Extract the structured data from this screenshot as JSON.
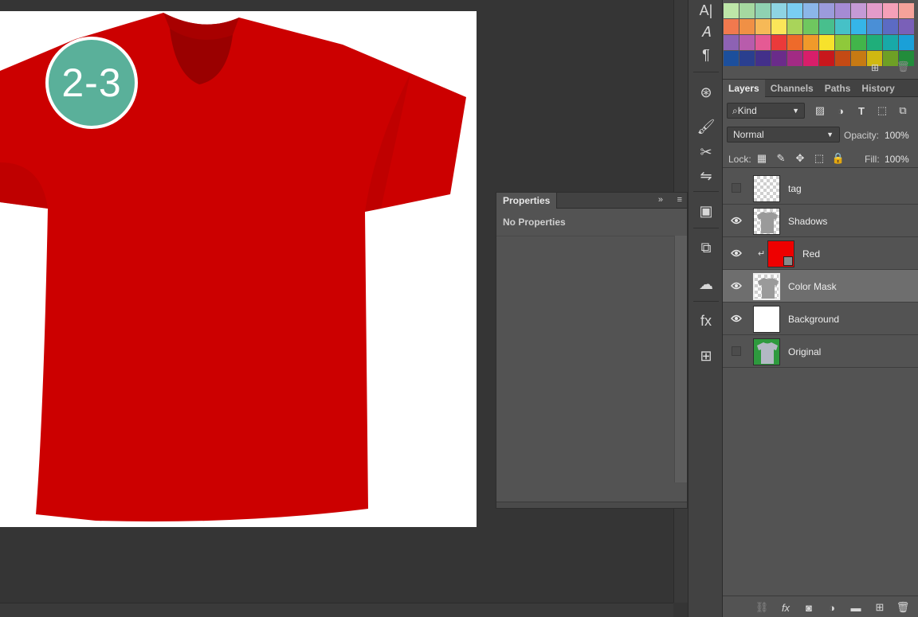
{
  "canvas": {
    "step_badge": "2-3",
    "shirt_color": "#cc0000"
  },
  "properties": {
    "tab_label": "Properties",
    "status": "No Properties",
    "collapse_glyph": "»",
    "menu_glyph": "≡"
  },
  "toolstrip": {
    "tools": [
      {
        "name": "character-icon",
        "glyph": "A|"
      },
      {
        "name": "character-styles-icon",
        "glyph": "𝐴"
      },
      {
        "name": "paragraph-icon",
        "glyph": "¶"
      },
      {
        "name": "target-icon",
        "glyph": "⊛"
      },
      {
        "name": "brushes-icon",
        "glyph": "🖌"
      },
      {
        "name": "tool-presets-icon",
        "glyph": "✂"
      },
      {
        "name": "adjustments-icon",
        "glyph": "⇋"
      },
      {
        "name": "3d-icon",
        "glyph": "▣"
      },
      {
        "name": "clone-source-icon",
        "glyph": "⧉"
      },
      {
        "name": "creative-cloud-icon",
        "glyph": "☁"
      },
      {
        "name": "styles-icon",
        "glyph": "fx"
      },
      {
        "name": "grid-icon",
        "glyph": "⊞"
      }
    ]
  },
  "swatches": {
    "colors": [
      "#bde6a8",
      "#a5d8a0",
      "#8fd1b2",
      "#8ed4e3",
      "#79cdf2",
      "#8bb6e8",
      "#9b9bdc",
      "#a58bd4",
      "#c49ad6",
      "#e39bc9",
      "#f6a0b8",
      "#f5a29a",
      "#f1794e",
      "#f09045",
      "#f6b957",
      "#fbe659",
      "#a9d45a",
      "#6fc75f",
      "#48bf8d",
      "#46c1c7",
      "#35b5e8",
      "#4a8fd6",
      "#5c6bc4",
      "#7a60b8",
      "#8d62b4",
      "#b85cac",
      "#e55a94",
      "#eb3a3a",
      "#ee6a2a",
      "#f09a2a",
      "#f7e22c",
      "#8fc93a",
      "#42b54a",
      "#1fae7a",
      "#18a9a8",
      "#1aa0d8",
      "#1c4f9c",
      "#2a3f8f",
      "#43308a",
      "#6a2c8a",
      "#a22b84",
      "#d81e6a",
      "#c8171c",
      "#c44a14",
      "#c77a13",
      "#d0b811",
      "#6ea025",
      "#228c3b"
    ],
    "new_icon": "⊞",
    "trash_icon": "🗑"
  },
  "layers_panel": {
    "tabs": [
      {
        "label": "Layers",
        "active": true
      },
      {
        "label": "Channels",
        "active": false
      },
      {
        "label": "Paths",
        "active": false
      },
      {
        "label": "History",
        "active": false
      }
    ],
    "filter_kind": "Kind",
    "filter_search_icon": "⌕",
    "blend_mode": "Normal",
    "opacity_label": "Opacity:",
    "opacity_value": "100%",
    "lock_label": "Lock:",
    "fill_label": "Fill:",
    "fill_value": "100%",
    "layers": [
      {
        "name": "tag",
        "visible": false,
        "thumb": "transparent",
        "selected": false,
        "clipped": false
      },
      {
        "name": "Shadows",
        "visible": true,
        "thumb": "shirt-gray",
        "selected": false,
        "clipped": false
      },
      {
        "name": "Red",
        "visible": true,
        "thumb": "solid-red",
        "selected": false,
        "clipped": true
      },
      {
        "name": "Color Mask",
        "visible": true,
        "thumb": "shirt-gray",
        "selected": true,
        "clipped": false
      },
      {
        "name": "Background",
        "visible": true,
        "thumb": "white",
        "selected": false,
        "clipped": false
      },
      {
        "name": "Original",
        "visible": false,
        "thumb": "shirt-green",
        "selected": false,
        "clipped": false
      }
    ]
  }
}
